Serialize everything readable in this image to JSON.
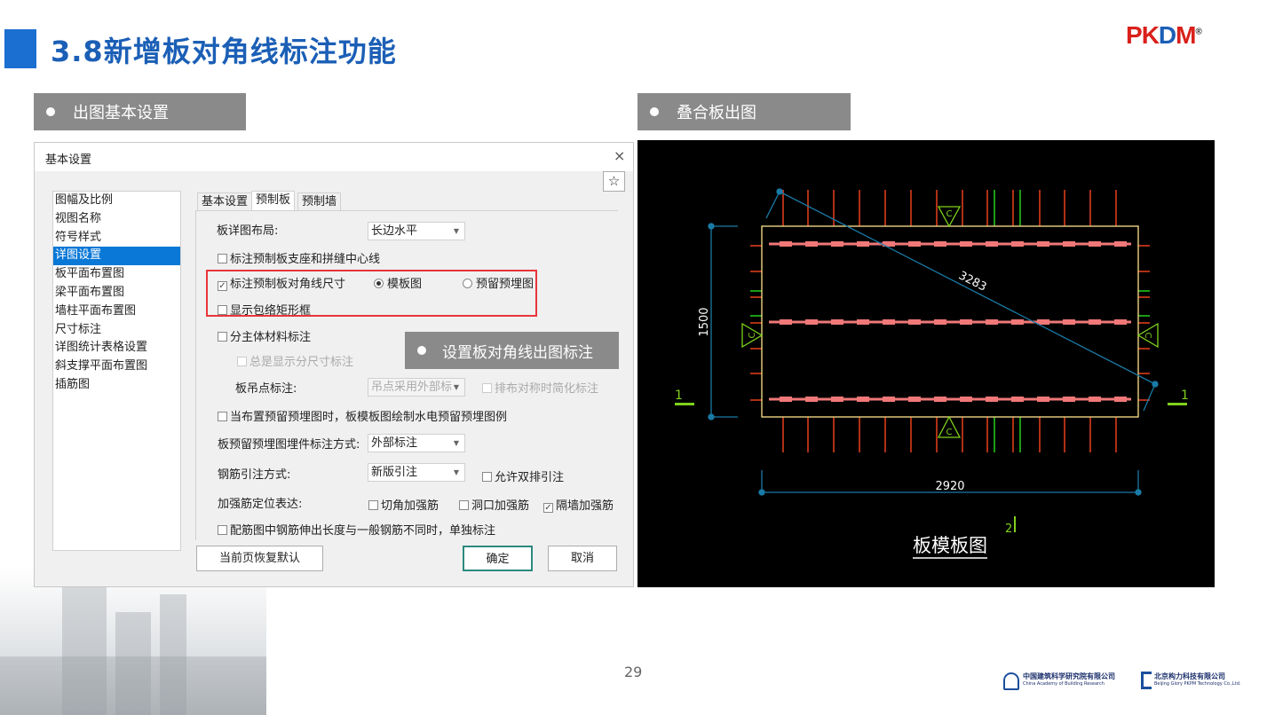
{
  "slide": {
    "title": "3.8新增板对角线标注功能",
    "logo": {
      "p": "P",
      "k": "K",
      "d": "D",
      "m": "M",
      "reg": "®"
    },
    "page_number": "29",
    "section_left": "出图基本设置",
    "section_right": "叠合板出图",
    "callout": "设置板对角线出图标注",
    "footer": {
      "org1_cn": "中国建筑科学研究院有限公司",
      "org1_en": "China Academy of Building Research",
      "org2_cn": "北京构力科技有限公司",
      "org2_en": "Beijing Glory PKPM Technology Co.,Ltd."
    }
  },
  "dialog": {
    "title": "基本设置",
    "close": "×",
    "star": "☆",
    "list": [
      "图幅及比例",
      "视图名称",
      "符号样式",
      "详图设置",
      "板平面布置图",
      "梁平面布置图",
      "墙柱平面布置图",
      "尺寸标注",
      "详图统计表格设置",
      "斜支撑平面布置图",
      "插筋图"
    ],
    "tabs": [
      "基本设置",
      "预制板",
      "预制墙"
    ],
    "layout_label": "板详图布局:",
    "layout_value": "长边水平",
    "opt_centerline": "标注预制板支座和拼缝中心线",
    "opt_diagonal": "标注预制板对角线尺寸",
    "radio_formwork": "模板图",
    "radio_embed": "预留预埋图",
    "opt_bbox": "显示包络矩形框",
    "opt_material": "分主体材料标注",
    "opt_always_sub": "总是显示分尺寸标注",
    "lift_label": "板吊点标注:",
    "lift_value": "吊点采用外部标",
    "opt_symmetric": "排布对称时简化标注",
    "opt_mep": "当布置预留预埋图时，板模板图绘制水电预留预埋图例",
    "embed_label": "板预留预埋图埋件标注方式:",
    "embed_value": "外部标注",
    "rebar_label": "钢筋引注方式:",
    "rebar_value": "新版引注",
    "opt_double": "允许双排引注",
    "reinf_label": "加强筋定位表达:",
    "reinf_corner": "切角加强筋",
    "reinf_hole": "洞口加强筋",
    "reinf_wall": "隔墙加强筋",
    "opt_extend": "配筋图中钢筋伸出长度与一般钢筋不同时，单独标注",
    "btn_reset": "当前页恢复默认",
    "btn_ok": "确定",
    "btn_cancel": "取消"
  },
  "cad": {
    "diag": "3283",
    "height": "1500",
    "width": "2920",
    "section": "1",
    "mark_c": "C",
    "view_no": "2",
    "caption": "板模板图"
  }
}
